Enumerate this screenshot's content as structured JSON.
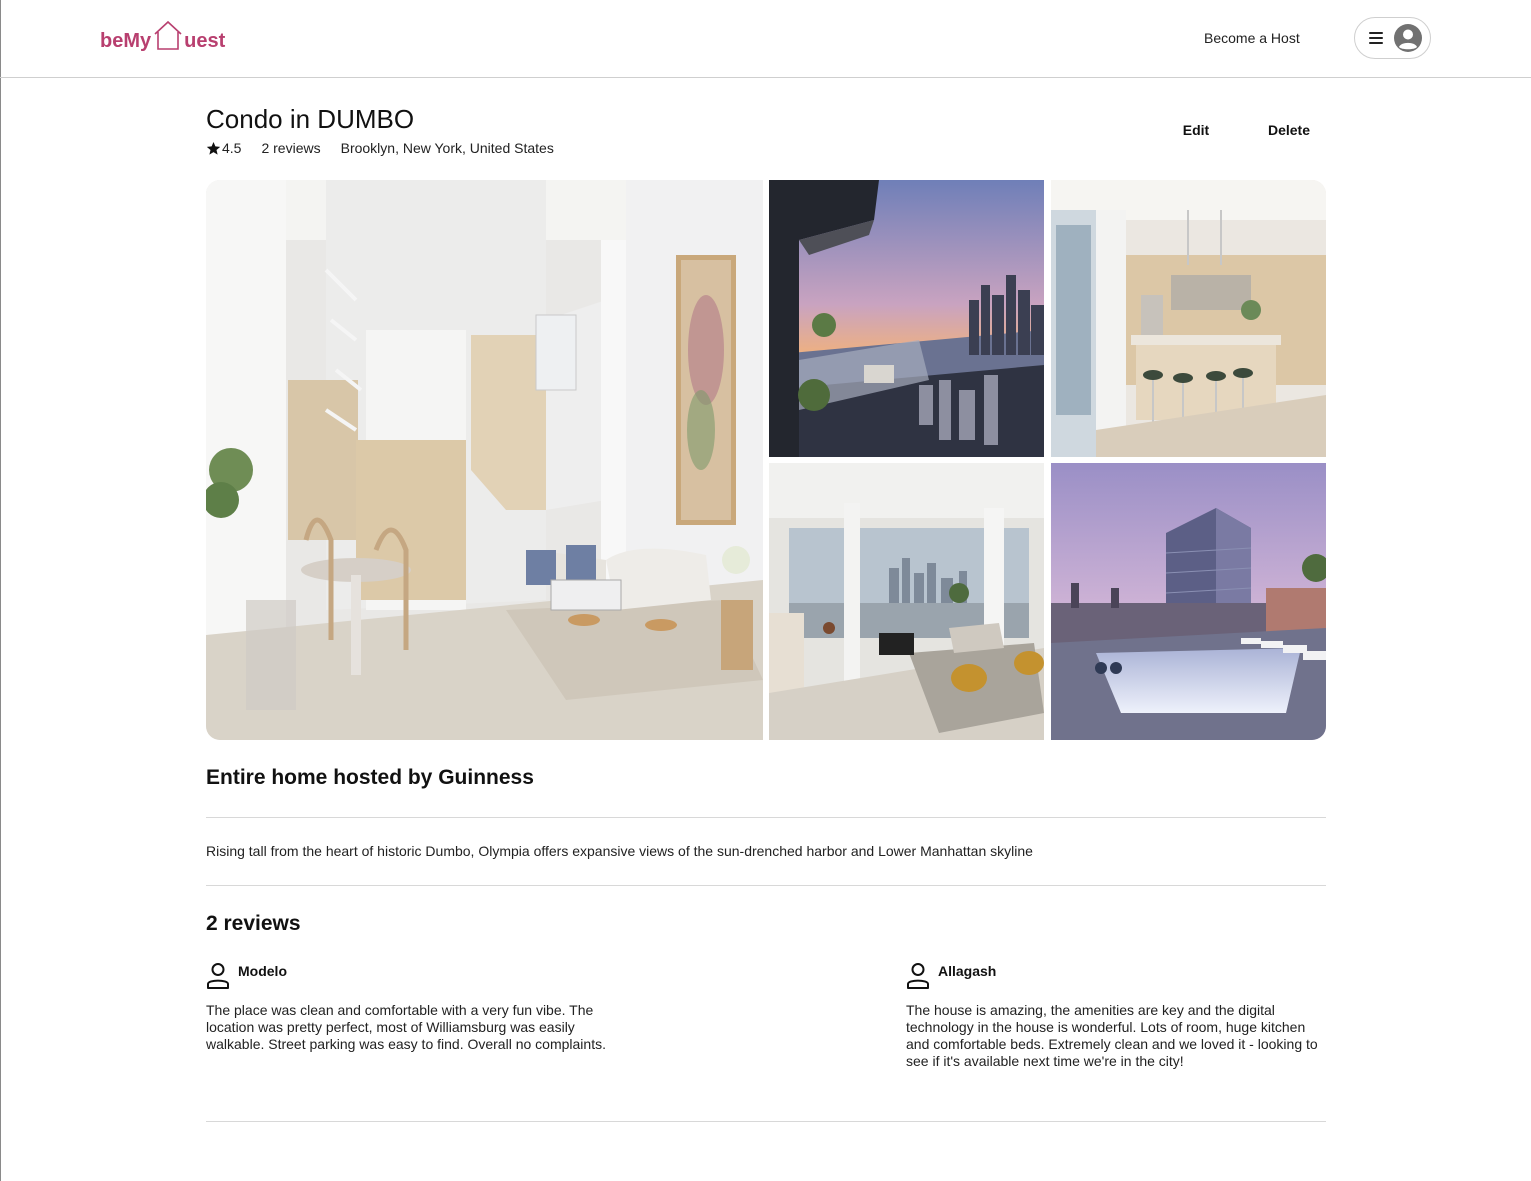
{
  "brand": {
    "logo_part1": "beMy",
    "logo_part2": "uest",
    "accent_color": "#b83f6f"
  },
  "header": {
    "become_host_label": "Become a Host",
    "menu_icon": "hamburger-menu-icon",
    "avatar_icon": "user-avatar-icon"
  },
  "listing": {
    "title": "Condo in DUMBO",
    "rating": "4.5",
    "reviews_count_label": "2 reviews",
    "location": "Brooklyn, New York, United States",
    "edit_label": "Edit",
    "delete_label": "Delete",
    "photos": [
      {
        "name": "living-room-loft",
        "icon": "photo"
      },
      {
        "name": "balcony-sunset-view",
        "icon": "photo"
      },
      {
        "name": "kitchen",
        "icon": "photo"
      },
      {
        "name": "living-room-skyline",
        "icon": "photo"
      },
      {
        "name": "rooftop-pool",
        "icon": "photo"
      }
    ],
    "host_heading": "Entire home hosted by Guinness",
    "description": "Rising tall from the heart of historic Dumbo, Olympia offers expansive views of the sun-drenched harbor and Lower Manhattan skyline"
  },
  "reviews": {
    "heading": "2 reviews",
    "items": [
      {
        "reviewer": "Modelo",
        "body": "The place was clean and comfortable with a very fun vibe. The location was pretty perfect, most of Williamsburg was easily walkable. Street parking was easy to find. Overall no complaints."
      },
      {
        "reviewer": "Allagash",
        "body": "The house is amazing, the amenities are key and the digital technology in the house is wonderful. Lots of room, huge kitchen and comfortable beds. Extremely clean and we loved it - looking to see if it's available next time we're in the city!"
      }
    ]
  }
}
